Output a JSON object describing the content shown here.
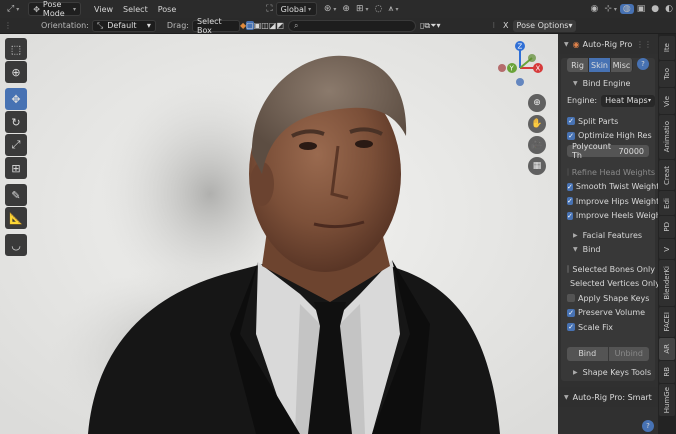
{
  "header": {
    "mode": "Pose Mode",
    "menus": [
      "View",
      "Select",
      "Pose"
    ],
    "transform_orientation": "Global",
    "pose_options": "Pose Options",
    "x_label": "X"
  },
  "toolbar2": {
    "orientation_label": "Orientation:",
    "orientation_value": "Default",
    "drag_label": "Drag:",
    "drag_value": "Select Box",
    "search_placeholder": ""
  },
  "gizmo": {
    "z": "Z",
    "y": "Y",
    "x": "X"
  },
  "panel": {
    "title": "Auto-Rig Pro",
    "tabs": [
      "Rig",
      "Skin",
      "Misc"
    ],
    "active_tab": "Skin",
    "bind_engine_header": "Bind Engine",
    "engine_label": "Engine:",
    "engine_value": "Heat Maps",
    "split_parts": "Split Parts",
    "optimize_high_res": "Optimize High Res",
    "polycount_label": "Polycount Th",
    "polycount_value": "70000",
    "refine_head_weights": "Refine Head Weights",
    "smooth_twist_weights": "Smooth Twist Weights",
    "improve_hips_weights": "Improve Hips Weights",
    "improve_heels_weights": "Improve Heels Weights",
    "facial_features": "Facial Features",
    "bind_header": "Bind",
    "selected_bones_only": "Selected Bones Only",
    "selected_vertices_only": "Selected Vertices Only",
    "apply_shape_keys": "Apply Shape Keys",
    "preserve_volume": "Preserve Volume",
    "scale_fix": "Scale Fix",
    "bind_button": "Bind",
    "unbind_button": "Unbind",
    "shape_keys_tools": "Shape Keys Tools",
    "smart_title": "Auto-Rig Pro: Smart"
  },
  "right_tabs": [
    "Ite",
    "Too",
    "Vie",
    "Animatio",
    "Creat",
    "Edi",
    "PD",
    "V",
    "BlenderKi",
    "FACEI",
    "AR",
    "RB",
    "HumGe"
  ],
  "colors": {
    "accent": "#4772b3",
    "panel_bg": "#303030",
    "viewport_bg": "#e8e8e6",
    "axis_x": "#d63a3a",
    "axis_y": "#6aa339",
    "axis_z": "#2f6fd6"
  }
}
